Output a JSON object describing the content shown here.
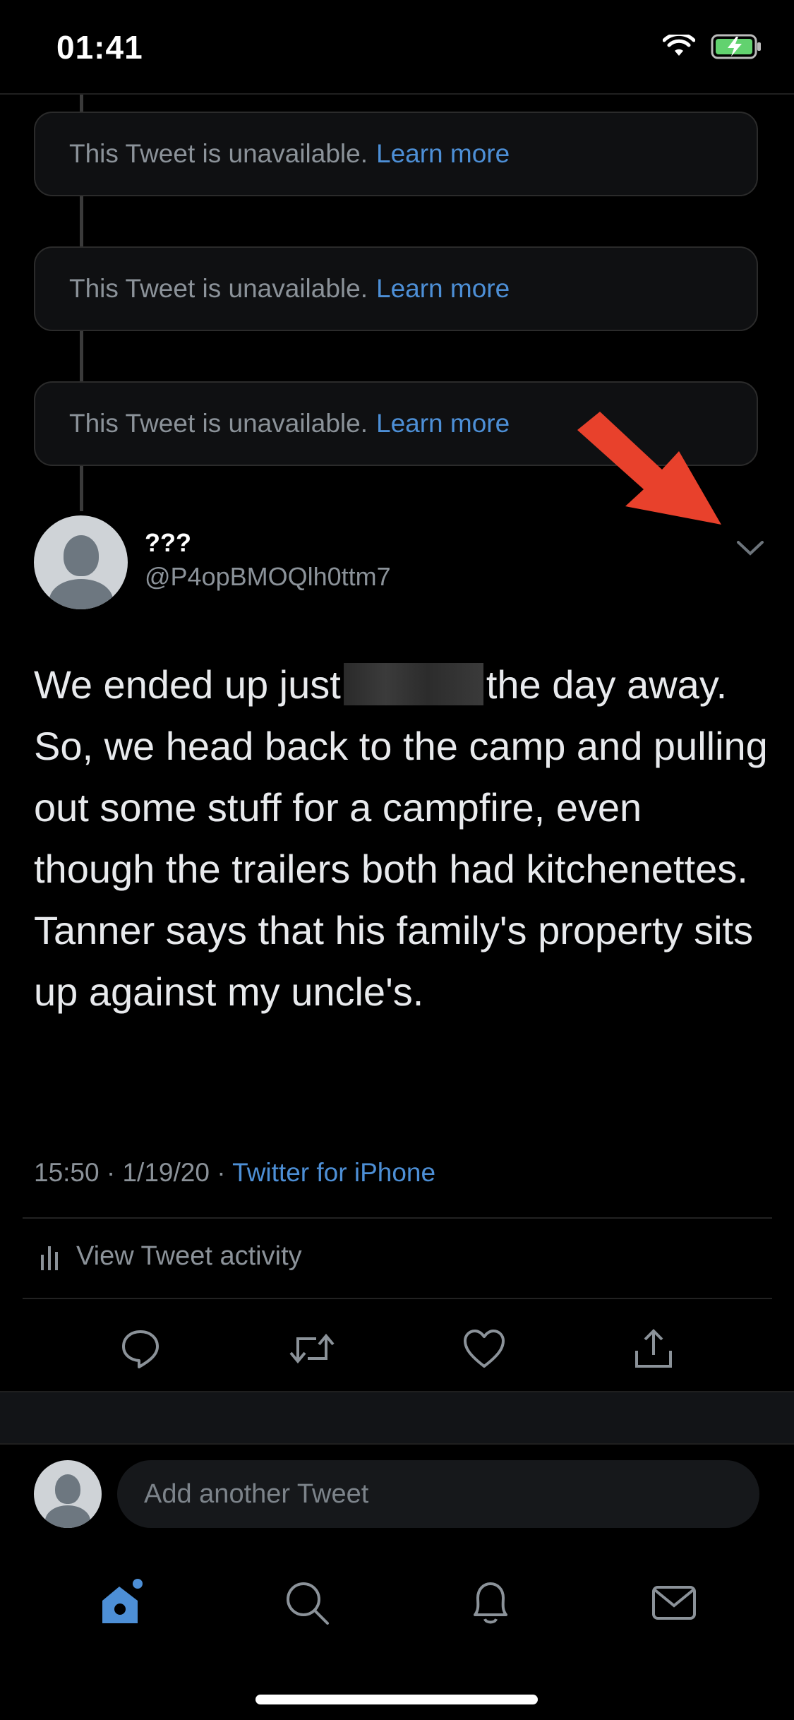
{
  "status_bar": {
    "time": "01:41"
  },
  "thread": {
    "unavailable_tweets": [
      {
        "text": "This Tweet is unavailable.",
        "link": "Learn more"
      },
      {
        "text": "This Tweet is unavailable.",
        "link": "Learn more"
      },
      {
        "text": "This Tweet is unavailable.",
        "link": "Learn more"
      }
    ]
  },
  "tweet": {
    "display_name": "???",
    "handle": "@P4opBMOQlh0ttm7",
    "body_part1": "We ended up just",
    "body_part2": "the day away. So, we head back to the camp and pulling out some stuff for a campfire, even though the trailers both had kitchenettes. Tanner says that his family's property sits up against my uncle's.",
    "time": "15:50",
    "date": "1/19/20",
    "source": "Twitter for iPhone",
    "activity_label": "View Tweet activity"
  },
  "reply": {
    "placeholder": "Add another Tweet"
  },
  "colors": {
    "accent": "#4d8fd6",
    "background": "#000000",
    "arrow": "#e8412c"
  }
}
